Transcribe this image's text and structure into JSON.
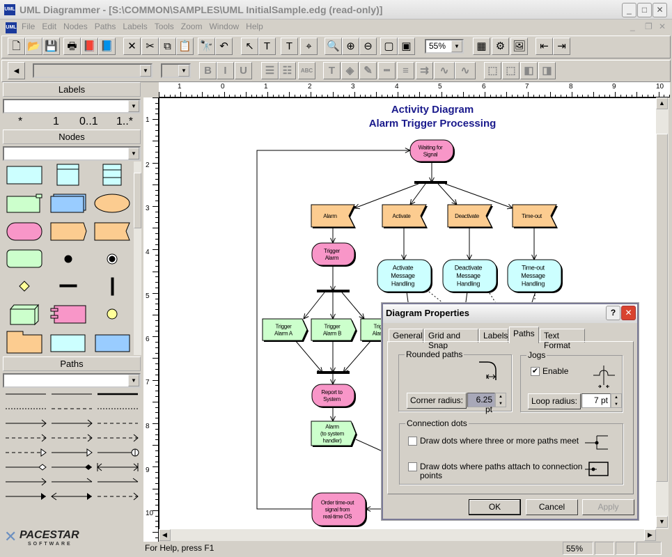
{
  "window": {
    "title": "UML Diagrammer - [S:\\COMMON\\SAMPLES\\UML InitialSample.edg (read-only)]",
    "app_icon": "UML",
    "controls": [
      "minimize",
      "maximize",
      "close"
    ]
  },
  "menu": [
    "File",
    "Edit",
    "Nodes",
    "Paths",
    "Labels",
    "Tools",
    "Zoom",
    "Window",
    "Help"
  ],
  "toolbar1": {
    "icons": [
      "new-file",
      "open-folder",
      "save",
      "print",
      "help-book",
      "help-book-blue",
      "delete",
      "cut",
      "copy",
      "paste",
      "find",
      "undo",
      "select-arrow",
      "select-text",
      "text-tool",
      "point-tool",
      "zoom-tool",
      "zoom-in",
      "zoom-out",
      "zoom-page",
      "zoom-fit"
    ],
    "zoom_value": "55%",
    "icons_right": [
      "grid",
      "layout",
      "picture",
      "back",
      "forward"
    ]
  },
  "toolbar2": {
    "icons": [
      "panel-toggle",
      "bold",
      "italic",
      "underline",
      "align-left",
      "align-justify",
      "abc",
      "text-color",
      "fill-color",
      "line-color",
      "line-style",
      "line-width",
      "arrow-style",
      "curve-style",
      "group",
      "ungroup",
      "bring-front",
      "send-back"
    ],
    "bold": "B",
    "italic": "I",
    "underline": "U",
    "abc": "ABC"
  },
  "left_panel": {
    "labels_header": "Labels",
    "label_items": [
      "*",
      "1",
      "0..1",
      "1..*"
    ],
    "nodes_header": "Nodes",
    "paths_header": "Paths",
    "logo": {
      "name": "PACESTAR",
      "sub": "SOFTWARE"
    }
  },
  "rulers": {
    "top": [
      "1",
      "0",
      "1",
      "2",
      "3",
      "4",
      "5",
      "6",
      "7",
      "8",
      "9",
      "10"
    ],
    "left": [
      "1",
      "2",
      "3",
      "4",
      "5",
      "6",
      "7",
      "8",
      "9",
      "10"
    ]
  },
  "diagram": {
    "title": "Activity Diagram",
    "subtitle": "Alarm Trigger Processing",
    "nodes": {
      "waiting": [
        "Waiting for",
        "Signal"
      ],
      "alarm": [
        "Alarm"
      ],
      "activate": [
        "Activate"
      ],
      "deactivate": [
        "Deactivate"
      ],
      "timeout": [
        "Time-out"
      ],
      "trigger": [
        "Trigger",
        "Alarm"
      ],
      "act_msg": [
        "Activate",
        "Message",
        "Handling"
      ],
      "deact_msg": [
        "Deactivate",
        "Message",
        "Handling"
      ],
      "to_msg": [
        "Time-out",
        "Message",
        "Handling"
      ],
      "trig_a": [
        "Trigger",
        "Alarm A"
      ],
      "trig_b": [
        "Trigger",
        "Alarm B"
      ],
      "trig_c": [
        "Trigger",
        "Alarm C"
      ],
      "report": [
        "Report to",
        "System"
      ],
      "alarm_sys": [
        "Alarm",
        "(to system",
        "handler)"
      ],
      "order": [
        "Order time-out",
        "signal from",
        "real-time OS"
      ]
    },
    "colors": {
      "pink": "#f896c8",
      "cyan": "#ccffff",
      "orange": "#fccc90",
      "green": "#ccffcc",
      "title": "#1a1a8c"
    }
  },
  "dialog": {
    "title": "Diagram Properties",
    "tabs": [
      "General",
      "Grid and Snap",
      "Labels",
      "Paths",
      "Text Format"
    ],
    "active_tab": "Paths",
    "rounded": {
      "legend": "Rounded paths",
      "button": "Corner radius:",
      "value": "6.25 pt"
    },
    "jogs": {
      "legend": "Jogs",
      "enable_label": "Enable",
      "enable_checked": true,
      "button": "Loop radius:",
      "value": "7 pt"
    },
    "dots": {
      "legend": "Connection dots",
      "opt1": "Draw dots where three or more paths meet",
      "opt1_checked": false,
      "opt2a": "Draw dots where paths attach to connection",
      "opt2b": "points",
      "opt2_checked": false
    },
    "ok": "OK",
    "cancel": "Cancel",
    "apply": "Apply"
  },
  "status": {
    "help": "For Help, press F1",
    "zoom": "55%"
  }
}
